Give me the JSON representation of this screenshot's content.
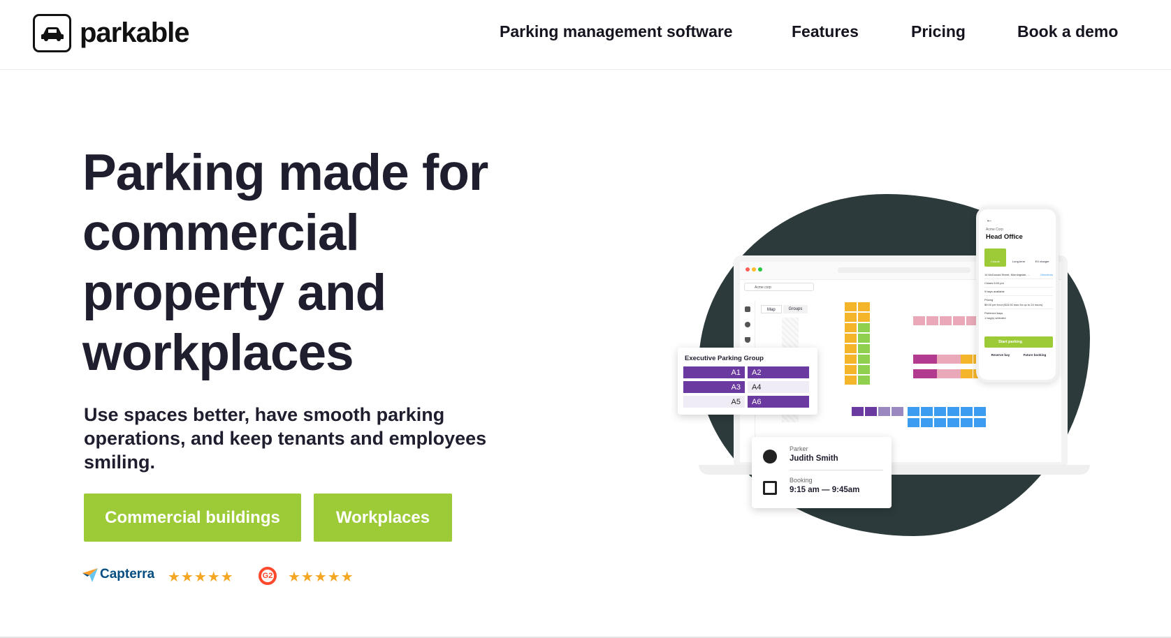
{
  "header": {
    "logo_text": "parkable",
    "nav": [
      "Parking management software",
      "Features",
      "Pricing",
      "Book a demo"
    ]
  },
  "hero": {
    "title_lines": [
      "Parking made for",
      "commercial",
      "property and",
      "workplaces"
    ],
    "subtitle": "Use spaces better, have smooth parking operations, and keep tenants and employees smiling.",
    "buttons": [
      "Commercial buildings",
      "Workplaces"
    ],
    "ratings": [
      {
        "name": "Capterra",
        "stars": "★★★★★"
      },
      {
        "name": "G2",
        "stars": "★★★★★"
      }
    ]
  },
  "illustration": {
    "phone": {
      "company": "Acme Corp",
      "title": "Head Office",
      "tabs": [
        "Casual",
        "Long-term",
        "EV charger"
      ],
      "address": "14 McDonald Street, Morningside, ...",
      "directions": "Directions",
      "closes": "Closes 6:00 pm",
      "bays": "9 bays available",
      "pricing_label": "Pricing",
      "pricing": "$9.00 per hour ($15.00 max for up to 24 hours)",
      "preferred_label": "Preferred bays",
      "preferred": "1 bay(s) selected",
      "start": "Start parking",
      "reserve": "Reserve bay",
      "future": "Future booking"
    },
    "app": {
      "org": "Acme corp",
      "tabs": [
        "Map",
        "Groups"
      ]
    },
    "group_card": {
      "title": "Executive Parking Group",
      "rows": [
        [
          "A1",
          "A2"
        ],
        [
          "A3",
          "A4"
        ],
        [
          "A5",
          "A6"
        ]
      ]
    },
    "booking_card": {
      "parker_label": "Parker",
      "parker": "Judith Smith",
      "booking_label": "Booking",
      "booking": "9:15 am — 9:45am"
    }
  },
  "colors": {
    "accent": "#9ccb37",
    "dark": "#1e1e2e",
    "blob": "#2c3a3c",
    "purple": "#6b3aa0",
    "yellow": "#f4b52b",
    "green": "#8fd14f",
    "blue": "#3b9cf0",
    "pink": "#e9a9b8",
    "magenta": "#b23a8f"
  }
}
